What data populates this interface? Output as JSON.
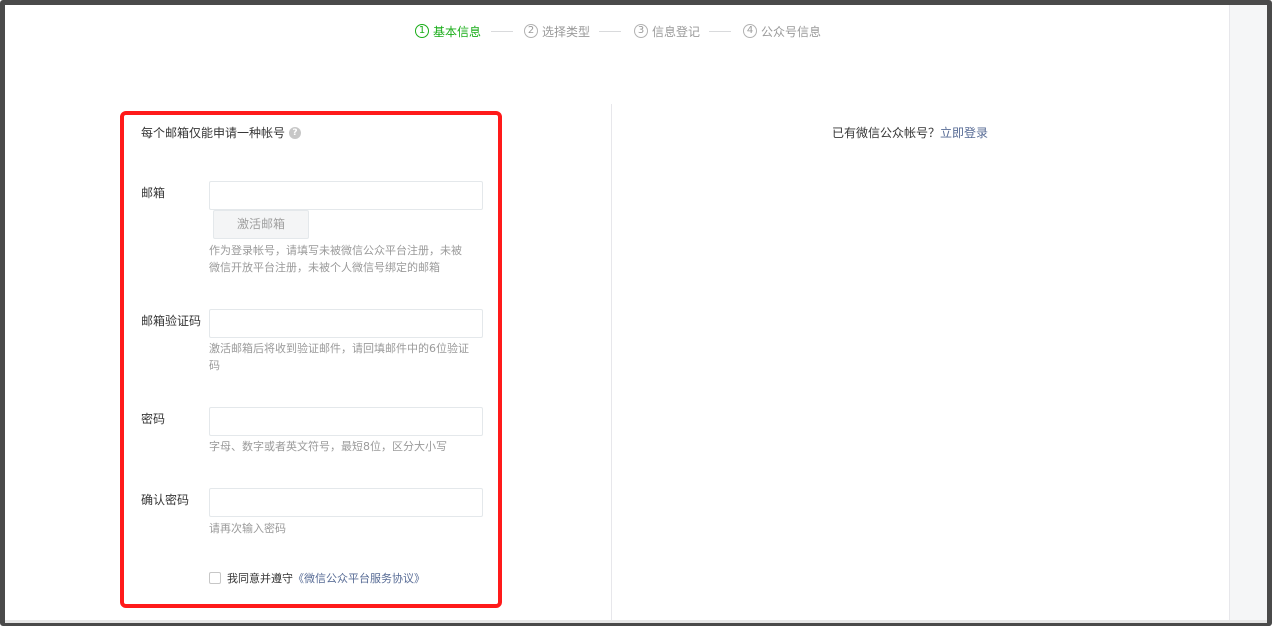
{
  "steps": [
    {
      "num": "1",
      "label": "基本信息",
      "active": true
    },
    {
      "num": "2",
      "label": "选择类型",
      "active": false
    },
    {
      "num": "3",
      "label": "信息登记",
      "active": false
    },
    {
      "num": "4",
      "label": "公众号信息",
      "active": false
    }
  ],
  "form": {
    "note": "每个邮箱仅能申请一种帐号",
    "help_icon": "?",
    "email": {
      "label": "邮箱",
      "value": "",
      "activate_button": "激活邮箱",
      "tip": "作为登录帐号，请填写未被微信公众平台注册，未被微信开放平台注册，未被个人微信号绑定的邮箱"
    },
    "code": {
      "label": "邮箱验证码",
      "value": "",
      "tip": "激活邮箱后将收到验证邮件，请回填邮件中的6位验证码"
    },
    "password": {
      "label": "密码",
      "value": "",
      "tip": "字母、数字或者英文符号，最短8位，区分大小写"
    },
    "confirm": {
      "label": "确认密码",
      "value": "",
      "tip": "请再次输入密码"
    },
    "agree": {
      "prefix": "我同意并遵守",
      "link": "《微信公众平台服务协议》",
      "checked": false
    }
  },
  "side": {
    "text": "已有微信公众帐号？",
    "link": "立即登录"
  },
  "colors": {
    "accent": "#1aad19",
    "link": "#576b95",
    "highlight": "#ff1a1a"
  }
}
